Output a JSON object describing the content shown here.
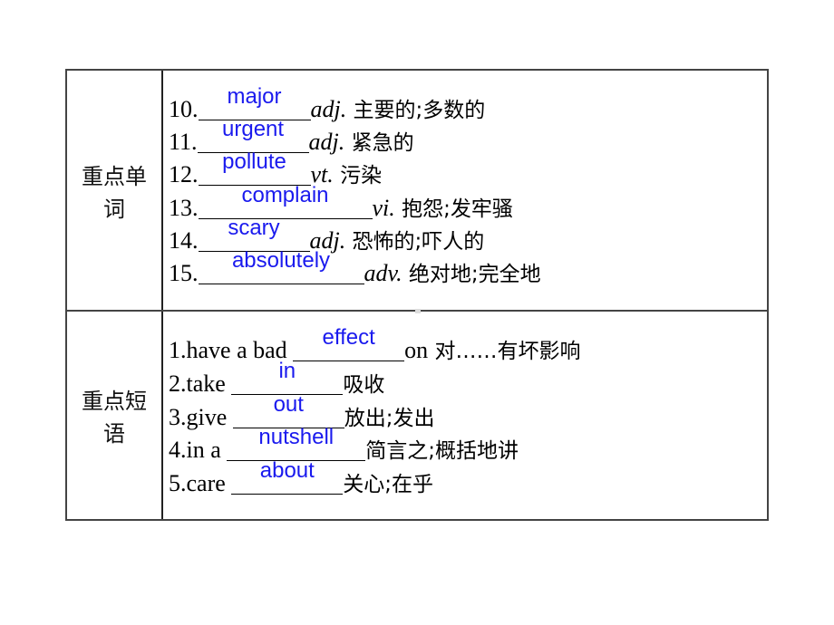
{
  "sections": [
    {
      "label_line1": "重点单",
      "label_line2": "词",
      "items": [
        {
          "num": "10.",
          "answer": "major",
          "pos": "adj.",
          "meaning": " 主要的;多数的"
        },
        {
          "num": "11.",
          "answer": "urgent",
          "pos": "adj.",
          "meaning": " 紧急的"
        },
        {
          "num": "12.",
          "answer": "pollute",
          "pos": "vt.",
          "meaning": " 污染"
        },
        {
          "num": "13.",
          "answer": "complain",
          "pos": "vi.",
          "meaning": " 抱怨;发牢骚"
        },
        {
          "num": "14.",
          "answer": "scary",
          "pos": "adj.",
          "meaning": " 恐怖的;吓人的"
        },
        {
          "num": "15.",
          "answer": "absolutely",
          "pos": "adv.",
          "meaning": " 绝对地;完全地"
        }
      ]
    },
    {
      "label_line1": "重点短",
      "label_line2": "语",
      "items": [
        {
          "prefix": "1.have a bad ",
          "answer": "effect",
          "suffix": "on",
          "meaning": " 对……有坏影响"
        },
        {
          "prefix": "2.take ",
          "answer": "in",
          "suffix": "",
          "meaning": "吸收"
        },
        {
          "prefix": "3.give ",
          "answer": "out",
          "suffix": "",
          "meaning": "放出;发出"
        },
        {
          "prefix": "4.in a ",
          "answer": "nutshell",
          "suffix": "",
          "meaning": "简言之;概括地讲"
        },
        {
          "prefix": "5.care ",
          "answer": "about",
          "suffix": "",
          "meaning": "关心;在乎"
        }
      ]
    }
  ]
}
